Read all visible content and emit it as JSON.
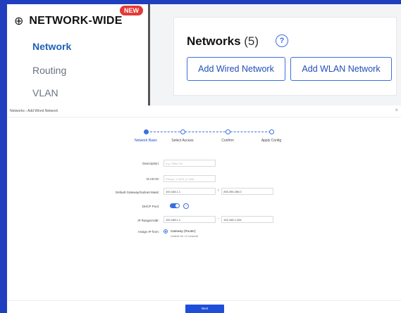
{
  "top_panel": {
    "section_title": "NETWORK-WIDE",
    "new_badge": "NEW",
    "nav_items": [
      "Network",
      "Routing",
      "VLAN"
    ],
    "networks_label": "Networks",
    "networks_count": "(5)",
    "add_wired_label": "Add Wired Network",
    "add_wlan_label": "Add WLAN Network",
    "icons": {
      "section": "globe-icon",
      "help": "help-icon"
    }
  },
  "modal": {
    "breadcrumb": "Networks  ›  Add Wired Network",
    "close_glyph": "×",
    "steps": [
      "Network Basic",
      "Select Access",
      "Confirm",
      "Apply Config"
    ],
    "fields": {
      "description_label": "Description:",
      "description_placeholder": "e.g. Office Wi",
      "vlan_label": "VLAN ID:",
      "vlan_placeholder": "Range: 1-4094 (1-255)",
      "gateway_label": "Default Gateway/Subnet Mask:",
      "gateway_value": "192.168.1.1",
      "mask_value": "255.255.255.0",
      "dhcp_label": "DHCP Pool:",
      "ip_range_label": "IP Range/Addr:",
      "ip_range_start": "192.168.1.1",
      "ip_range_end": "192.168.1.254",
      "assign_label": "Assign IP from:",
      "assign_option": "Gateway (Router)",
      "assign_sub": "Unable for L2 network"
    },
    "next_label": "Next"
  },
  "colors": {
    "frame": "#1f3fbf",
    "accent": "#3b6fe0",
    "badge": "#e53935"
  }
}
